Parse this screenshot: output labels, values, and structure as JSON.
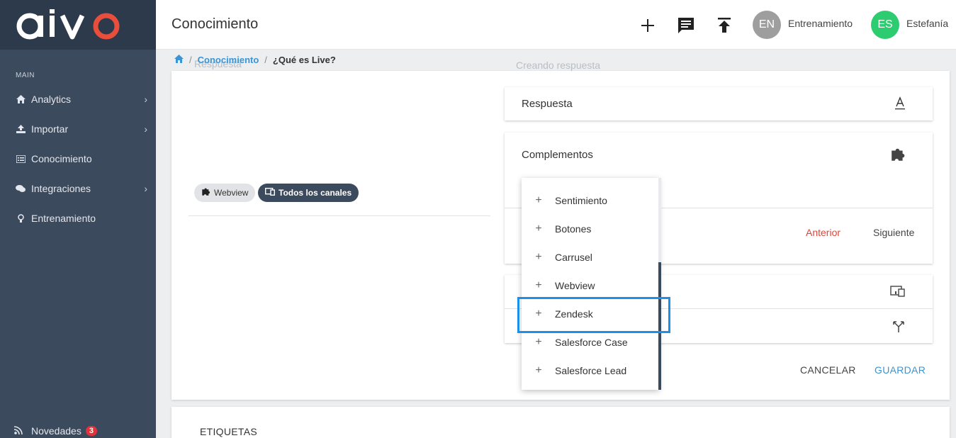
{
  "app": {
    "logo": "aivo"
  },
  "sidebar": {
    "section": "MAIN",
    "items": [
      {
        "label": "Analytics",
        "icon": "home-icon",
        "has_chevron": true
      },
      {
        "label": "Importar",
        "icon": "upload-icon",
        "has_chevron": true
      },
      {
        "label": "Conocimiento",
        "icon": "list-icon",
        "has_chevron": false
      },
      {
        "label": "Integraciones",
        "icon": "chat-bubbles-icon",
        "has_chevron": true
      },
      {
        "label": "Entrenamiento",
        "icon": "lightbulb-icon",
        "has_chevron": false
      }
    ],
    "novedades": {
      "label": "Novedades",
      "count": "3"
    }
  },
  "header": {
    "title": "Conocimiento",
    "users": [
      {
        "initials": "EN",
        "name": "Entrenamiento",
        "color": "#9e9e9e"
      },
      {
        "initials": "ES",
        "name": "Estefanía",
        "color": "#2ecc71"
      }
    ]
  },
  "breadcrumb": {
    "link": "Conocimiento",
    "current": "¿Qué es Live?",
    "sep": "/"
  },
  "ghost": {
    "left": "Respuesta",
    "right": "Creando respuesta"
  },
  "chips": {
    "webview": "Webview",
    "channels": "Todos los canales"
  },
  "panels": {
    "respuesta": "Respuesta",
    "complementos": "Complementos"
  },
  "nav_links": {
    "prev": "Anterior",
    "next": "Siguiente"
  },
  "actions": {
    "cancel": "CANCELAR",
    "save": "GUARDAR"
  },
  "dropdown": {
    "items": [
      "Sentimiento",
      "Botones",
      "Carrusel",
      "Webview",
      "Zendesk",
      "Salesforce Case",
      "Salesforce Lead"
    ],
    "highlighted": "Zendesk"
  },
  "lower_card": {
    "title": "ETIQUETAS"
  },
  "colors": {
    "sidebar": "#3c4a5d",
    "accent": "#3b94d4",
    "danger": "#e0473c",
    "highlight": "#1c8fe8"
  }
}
